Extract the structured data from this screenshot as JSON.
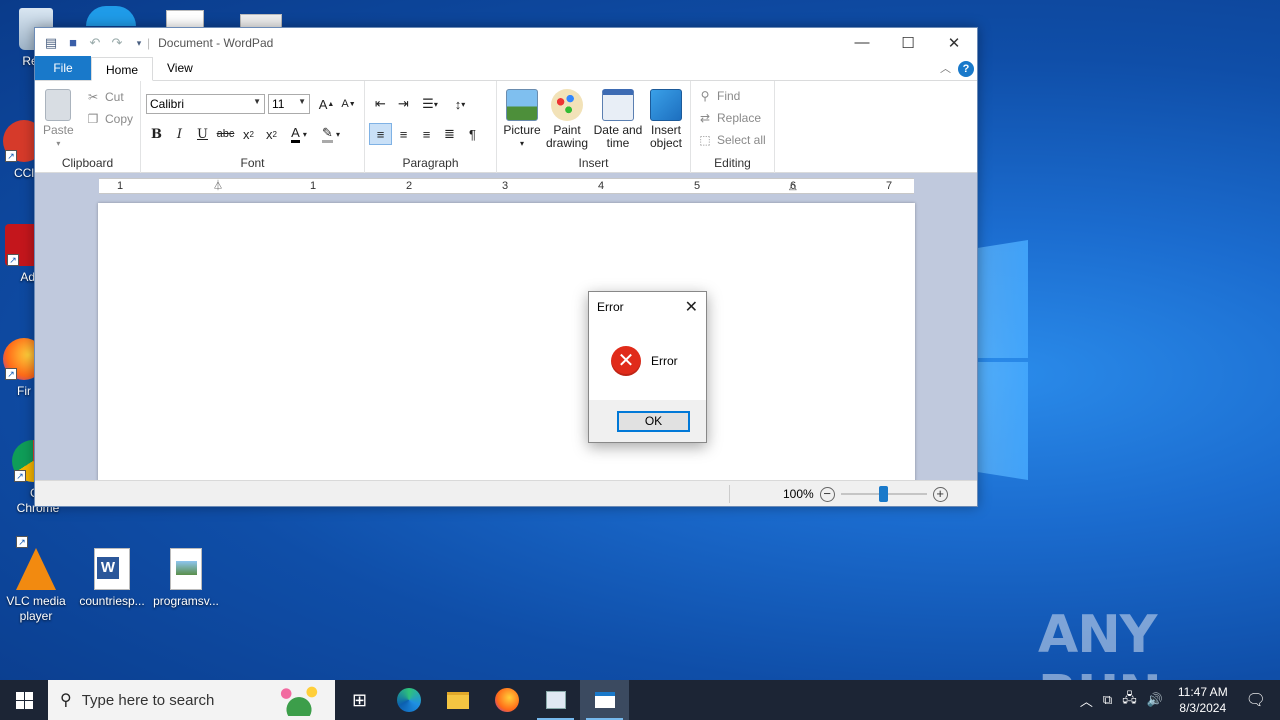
{
  "desktop": {
    "icons": [
      {
        "label": "Recy",
        "icon": "recycle-bin-icon"
      },
      {
        "label": "CCl",
        "icon": "ccleaner-icon"
      },
      {
        "label": "Ad Acr",
        "icon": "adobe-acrobat-icon"
      },
      {
        "label": "Fir",
        "icon": "firefox-icon"
      },
      {
        "label": "Go Chrome",
        "icon": "chrome-icon"
      },
      {
        "label": "VLC media player",
        "icon": "vlc-icon"
      },
      {
        "label": "countriesp...",
        "icon": "word-document-icon"
      },
      {
        "label": "programsv...",
        "icon": "image-file-icon"
      }
    ],
    "watermark": "ANY RUN"
  },
  "wordpad": {
    "title": "Document - WordPad",
    "tabs": [
      "File",
      "Home",
      "View"
    ],
    "clipboard": {
      "paste": "Paste",
      "cut": "Cut",
      "copy": "Copy",
      "label": "Clipboard"
    },
    "font": {
      "family": "Calibri",
      "size": "11",
      "label": "Font"
    },
    "paragraph": {
      "label": "Paragraph"
    },
    "insert": {
      "picture": "Picture",
      "paint": "Paint drawing",
      "datetime": "Date and time",
      "object": "Insert object",
      "label": "Insert"
    },
    "editing": {
      "find": "Find",
      "replace": "Replace",
      "select_all": "Select all",
      "label": "Editing"
    },
    "ruler_numbers": [
      "1",
      "1",
      "2",
      "3",
      "4",
      "5",
      "6",
      "7"
    ],
    "status": {
      "zoom": "100%",
      "zoom_fraction": 0.5
    }
  },
  "dialog": {
    "title": "Error",
    "message": "Error",
    "ok": "OK"
  },
  "taskbar": {
    "search_placeholder": "Type here to search",
    "time": "11:47 AM",
    "date": "8/3/2024"
  },
  "colors": {
    "accent": "#1979ca",
    "error": "#e02b1a",
    "taskbar": "#1c2535"
  }
}
